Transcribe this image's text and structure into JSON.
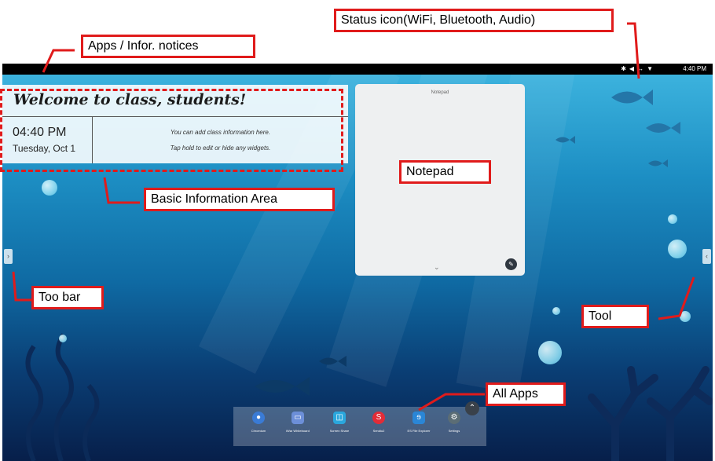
{
  "status_bar": {
    "time": "4:40 PM",
    "icons": [
      "bluetooth-icon",
      "volume-icon",
      "ethernet-icon",
      "wifi-icon"
    ]
  },
  "info_widget": {
    "welcome": "Welcome to class, students!",
    "time": "04:40 PM",
    "date": "Tuesday, Oct 1",
    "line1": "You can add class information here.",
    "line2": "Tap hold to edit or hide any widgets."
  },
  "notepad": {
    "title": "Notepad"
  },
  "dock": {
    "apps": [
      {
        "label": "Chromium",
        "icon": "chromium-icon",
        "color": "#3a7bd5"
      },
      {
        "label": "iWar Whiteboard",
        "icon": "whiteboard-icon",
        "color": "#6c8fd8"
      },
      {
        "label": "Screen Share",
        "icon": "cast-icon",
        "color": "#2aa7dd"
      },
      {
        "label": "Sendio2",
        "icon": "sendio-icon",
        "color": "#e22c37"
      },
      {
        "label": "ES File Explorer",
        "icon": "file-explorer-icon",
        "color": "#2a86d6"
      },
      {
        "label": "Settings",
        "icon": "gear-icon",
        "color": "#5b6d75"
      }
    ]
  },
  "annotations": {
    "apps_notices": "Apps / Infor. notices",
    "status_icon": "Status icon(WiFi, Bluetooth, Audio)",
    "basic_info": "Basic Information Area",
    "notepad": "Notepad",
    "toolbar": "Too bar",
    "tool": "Tool",
    "all_apps": "All Apps"
  },
  "colors": {
    "callout_border": "#e01b1b",
    "status_bar": "#000000",
    "notepad_bg": "#eef0f1"
  }
}
